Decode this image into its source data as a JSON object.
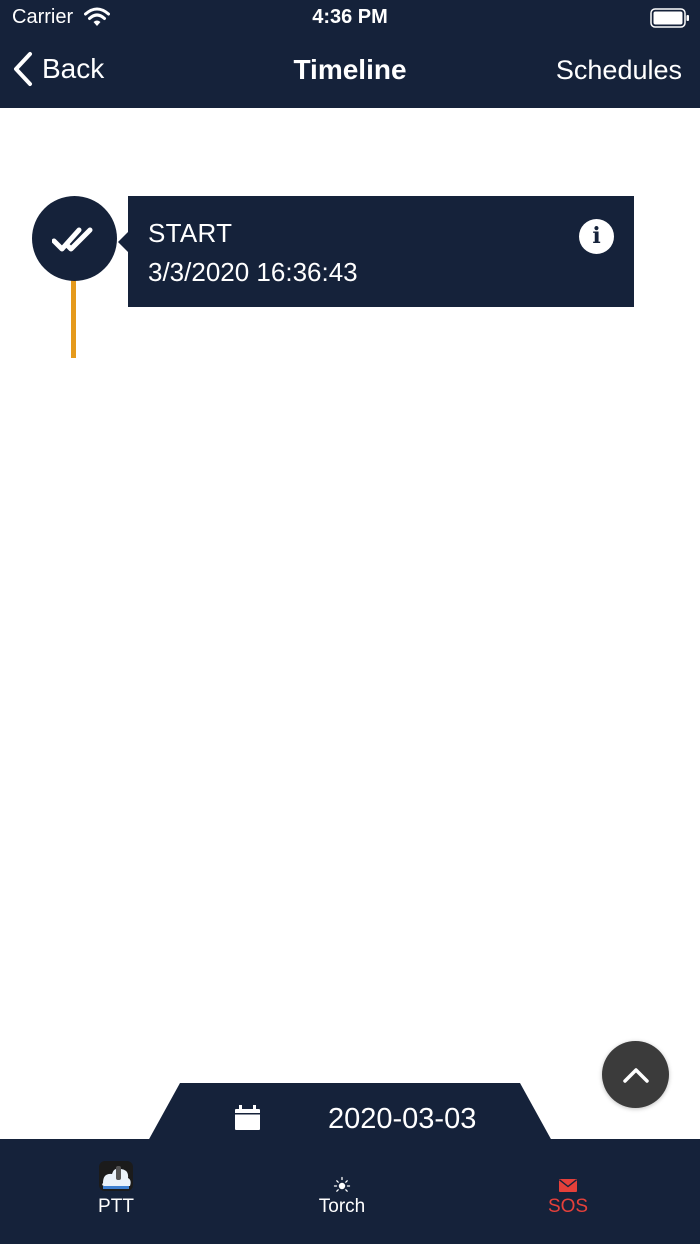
{
  "status_bar": {
    "carrier": "Carrier",
    "time": "4:36 PM"
  },
  "nav": {
    "back_label": "Back",
    "title": "Timeline",
    "right_label": "Schedules"
  },
  "timeline": {
    "events": [
      {
        "title": "START",
        "timestamp": "3/3/2020 16:36:43",
        "icon": "double-check-icon",
        "info_glyph": "i"
      }
    ]
  },
  "date_selector": {
    "date": "2020-03-03",
    "icon": "calendar-icon"
  },
  "tab_bar": {
    "items": [
      {
        "label": "PTT",
        "icon": "ptt-app-icon"
      },
      {
        "label": "Torch",
        "icon": "sun-icon"
      },
      {
        "label": "SOS",
        "icon": "envelope-icon"
      }
    ]
  },
  "colors": {
    "navy": "#15223a",
    "timeline_accent": "#e59a1c",
    "sos_red": "#e5403a",
    "scroll_button": "#3b3b3b"
  }
}
